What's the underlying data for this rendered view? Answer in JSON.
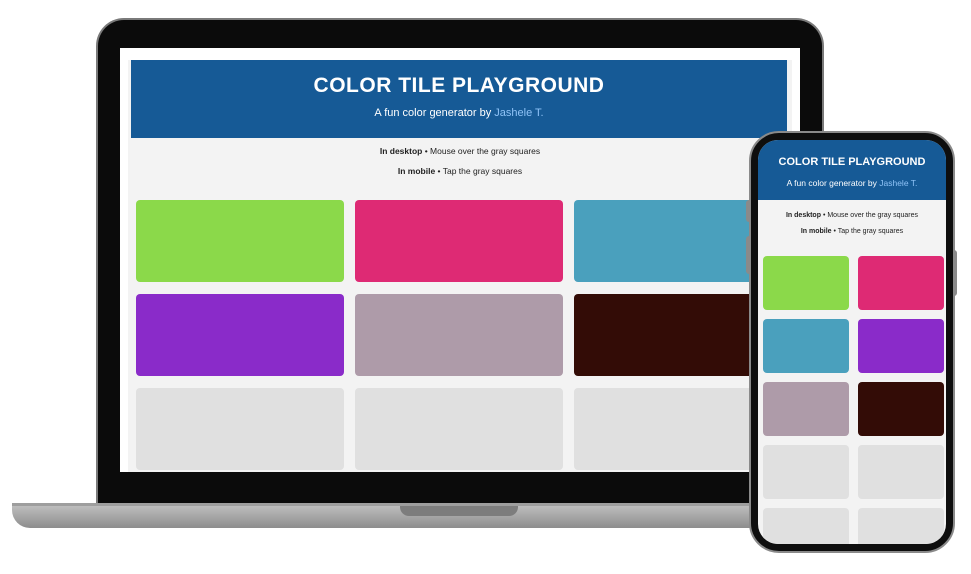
{
  "app": {
    "title": "COLOR TILE PLAYGROUND",
    "subtitle_prefix": "A fun color generator by",
    "author": "Jashele T.",
    "desktop_label": "In desktop",
    "desktop_text": " • Mouse over the gray squares",
    "mobile_label": "In mobile",
    "mobile_text": " • Tap the gray squares"
  },
  "colors": {
    "header": "#165a96",
    "background": "#f3f3f3",
    "gray_tile": "#e0e0e0",
    "link": "#8fc3f7"
  },
  "tiles": [
    {
      "id": "green",
      "color": "#8bd94a"
    },
    {
      "id": "pink",
      "color": "#de2a74"
    },
    {
      "id": "teal",
      "color": "#4aa0bd"
    },
    {
      "id": "purple",
      "color": "#8a2bc9"
    },
    {
      "id": "mauve",
      "color": "#ae9ba9"
    },
    {
      "id": "maroon",
      "color": "#330c06"
    },
    {
      "id": "gray1",
      "color": "#e0e0e0"
    },
    {
      "id": "gray2",
      "color": "#e0e0e0"
    },
    {
      "id": "gray3",
      "color": "#e0e0e0"
    },
    {
      "id": "gray4",
      "color": "#e0e0e0"
    },
    {
      "id": "gray5",
      "color": "#e0e0e0"
    }
  ]
}
